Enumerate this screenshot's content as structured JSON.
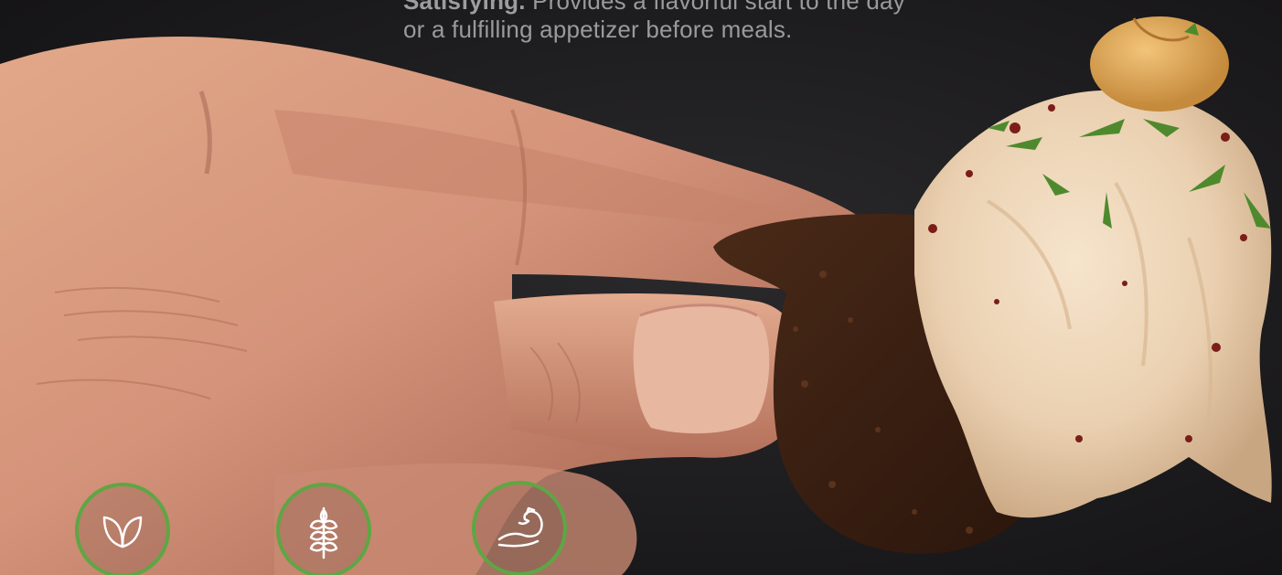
{
  "caption": {
    "lead": "Satisfying.",
    "line1_rest": "Provides a flavorful start to the day",
    "line2": "or a fulfilling appetizer before meals."
  },
  "badges": [
    {
      "icon": "leaves-icon"
    },
    {
      "icon": "wheat-icon"
    },
    {
      "icon": "flexed-arm-icon"
    }
  ],
  "colors": {
    "background": "#1e1d1f",
    "badge_ring": "#5ea644",
    "caption_text": "#9b9a9b"
  }
}
